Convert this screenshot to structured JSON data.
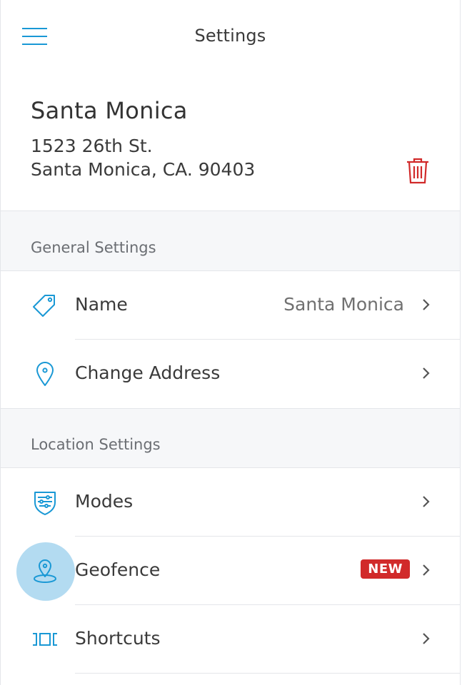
{
  "header": {
    "title": "Settings",
    "menu_icon": "hamburger-menu-icon"
  },
  "location": {
    "name": "Santa Monica",
    "address_line1": "1523 26th St.",
    "address_line2": "Santa Monica, CA. 90403",
    "delete_icon": "trash-icon"
  },
  "general": {
    "heading": "General Settings",
    "items": [
      {
        "label": "Name",
        "value": "Santa Monica",
        "icon": "tag-icon"
      },
      {
        "label": "Change Address",
        "value": "",
        "icon": "map-pin-icon"
      }
    ]
  },
  "location_settings": {
    "heading": "Location Settings",
    "items": [
      {
        "label": "Modes",
        "icon": "modes-shield-icon"
      },
      {
        "label": "Geofence",
        "badge": "NEW",
        "icon": "geofence-pin-icon"
      },
      {
        "label": "Shortcuts",
        "icon": "shortcuts-icon"
      }
    ]
  },
  "colors": {
    "accent": "#1998d5",
    "danger": "#d12a2a",
    "section_bg": "#f6f7f9"
  }
}
